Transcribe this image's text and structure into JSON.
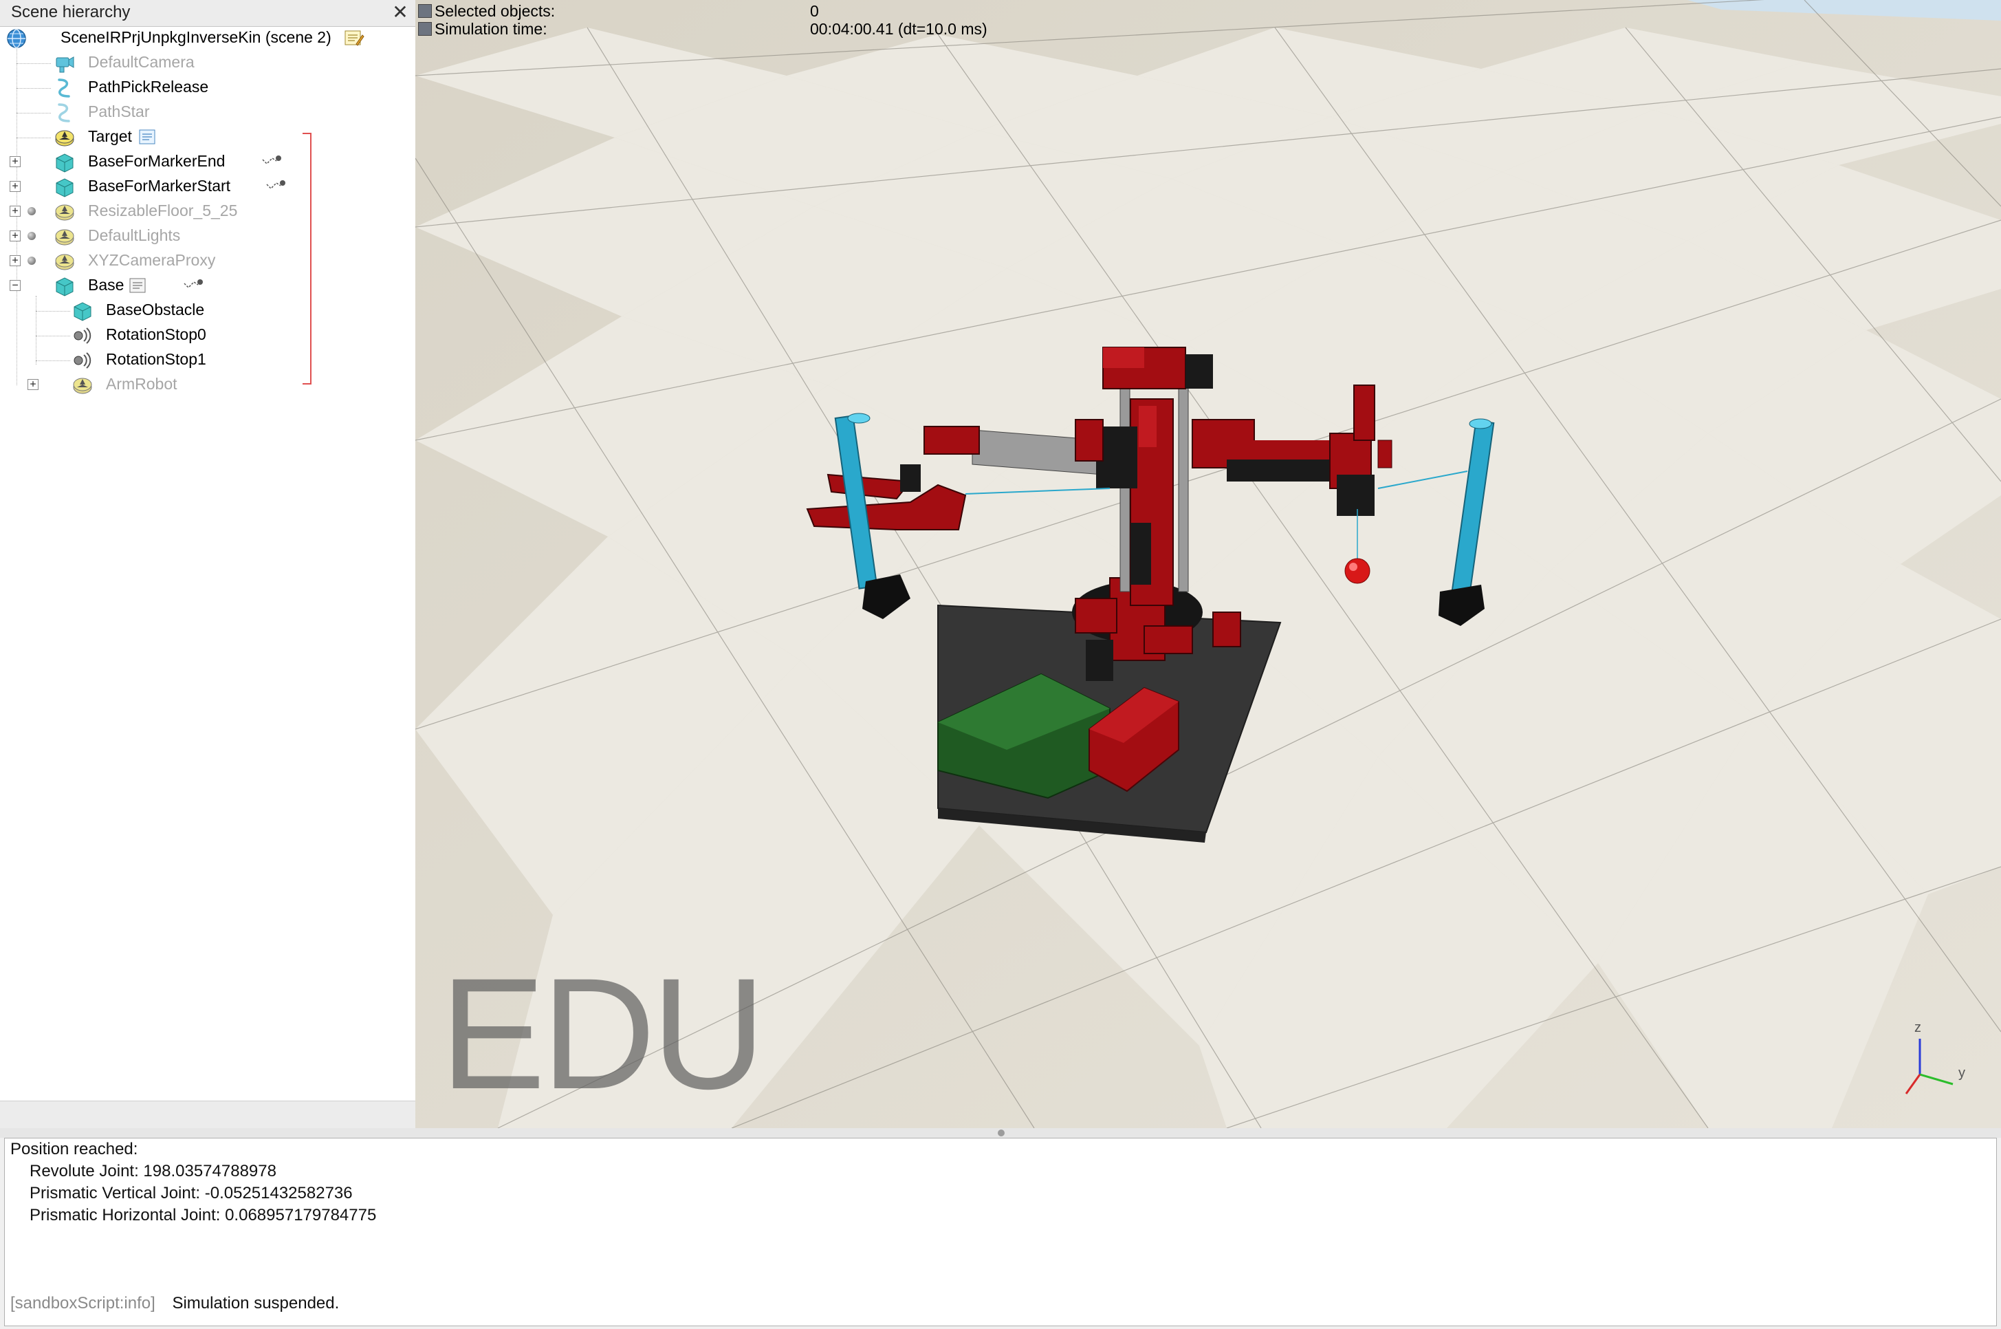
{
  "hierarchy": {
    "title": "Scene hierarchy",
    "close_glyph": "✕",
    "scene_name": "SceneIRPrjUnpkgInverseKin (scene 2)",
    "items": [
      {
        "label": "DefaultCamera",
        "icon": "camera-icon",
        "dimmed": true
      },
      {
        "label": "PathPickRelease",
        "icon": "path-icon",
        "dimmed": false
      },
      {
        "label": "PathStar",
        "icon": "path-icon",
        "dimmed": true
      },
      {
        "label": "Target",
        "icon": "dummy-icon",
        "dimmed": false
      },
      {
        "label": "BaseForMarkerEnd",
        "icon": "shape-icon",
        "dimmed": false
      },
      {
        "label": "BaseForMarkerStart",
        "icon": "shape-icon",
        "dimmed": false
      },
      {
        "label": "ResizableFloor_5_25",
        "icon": "dummy-icon",
        "dimmed": true
      },
      {
        "label": "DefaultLights",
        "icon": "dummy-icon",
        "dimmed": true
      },
      {
        "label": "XYZCameraProxy",
        "icon": "dummy-icon",
        "dimmed": true
      },
      {
        "label": "Base",
        "icon": "shape-icon",
        "dimmed": false
      },
      {
        "label": "BaseObstacle",
        "icon": "shape-icon",
        "dimmed": false
      },
      {
        "label": "RotationStop0",
        "icon": "proximity-sensor-icon",
        "dimmed": false
      },
      {
        "label": "RotationStop1",
        "icon": "proximity-sensor-icon",
        "dimmed": false
      },
      {
        "label": "ArmRobot",
        "icon": "dummy-icon",
        "dimmed": true
      }
    ]
  },
  "info": {
    "selected_label": "Selected objects:",
    "selected_value": "0",
    "simtime_label": "Simulation time:",
    "simtime_value": "00:04:00.41 (dt=10.0 ms)"
  },
  "viewport": {
    "watermark": "EDU",
    "axes": {
      "z": "z",
      "y": "y"
    }
  },
  "console": {
    "lines": [
      "Position reached:",
      "Revolute Joint: 198.03574788978",
      "Prismatic Vertical Joint: -0.05251432582736",
      "Prismatic Horizontal Joint: 0.068957179784775"
    ],
    "status_tag": "[sandboxScript:info]",
    "status_text": "Simulation suspended."
  },
  "colors": {
    "robot_red": "#a30d12",
    "robot_black": "#1a1a1a",
    "marker_blue": "#2aa8cc",
    "obstacle_green": "#1f5a22",
    "target_red": "#d81818"
  }
}
